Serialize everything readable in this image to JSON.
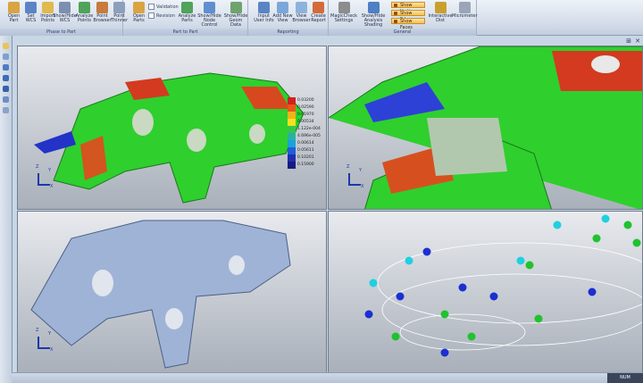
{
  "ribbon": {
    "groups": [
      {
        "title": "Phase to Part"
      },
      {
        "title": "Part to Part"
      },
      {
        "title": "Reporting"
      },
      {
        "title": "General"
      }
    ],
    "buttons": [
      {
        "label": "Open\nPart",
        "color": "#d9a441"
      },
      {
        "label": "Set\nWCS",
        "color": "#5a84c6"
      },
      {
        "label": "Import\nPoints",
        "color": "#e0b94f"
      },
      {
        "label": "Show/Hide\nWCS",
        "color": "#7b8fb0"
      },
      {
        "label": "Analyze\nPoints",
        "color": "#4fa35b"
      },
      {
        "label": "Point\nBrowser",
        "color": "#c77b3d"
      },
      {
        "label": "Point\nThinner",
        "color": "#8c9fbc"
      },
      {
        "label": "Open\nParts",
        "color": "#d9a441"
      },
      {
        "label": "Analyze\nParts",
        "color": "#4fa35b"
      },
      {
        "label": "Show/Hide\nNode Control",
        "color": "#5f8fd1"
      },
      {
        "label": "Show/Hide\nGeom Data",
        "color": "#6fa36e"
      },
      {
        "label": "Input\nUser Info",
        "color": "#5a84c6"
      },
      {
        "label": "Add New\nView",
        "color": "#7aa7d9"
      },
      {
        "label": "View\nBrowser",
        "color": "#8eb2de"
      },
      {
        "label": "Create\nReport",
        "color": "#d46c3a"
      },
      {
        "label": "MagicCheck\nSettings",
        "color": "#8d8d8d"
      },
      {
        "label": "Show/Hide\nAnalysis Shading",
        "color": "#4f7fc4"
      },
      {
        "label": "Interactive\nDist",
        "color": "#c9a030"
      },
      {
        "label": "Micrometer",
        "color": "#9aa5b8"
      }
    ],
    "checks": {
      "validation": "Validation",
      "revision": "Revision"
    },
    "toggles": [
      "Show Vertices",
      "Show Edges",
      "Show Faces"
    ]
  },
  "legend": {
    "entries": [
      {
        "label": "0.03200",
        "color": "#d31f1f"
      },
      {
        "label": "0.02590",
        "color": "#e8561a"
      },
      {
        "label": "0.01970",
        "color": "#f2b21a"
      },
      {
        "label": "0.00534",
        "color": "#f5e21d"
      },
      {
        "label": "1.122e-004",
        "color": "#33c64a"
      },
      {
        "label": "4.696e-005",
        "color": "#27b3a3"
      },
      {
        "label": "0.00614",
        "color": "#1aa3d8"
      },
      {
        "label": "0.05611",
        "color": "#1f5ed8"
      },
      {
        "label": "0.10201",
        "color": "#1c2fb0"
      },
      {
        "label": "0.15900",
        "color": "#161b80"
      }
    ]
  },
  "axis": {
    "x": "X",
    "y": "Y",
    "z": "Z"
  },
  "status": {
    "mode": "NUM"
  },
  "window": {
    "pin": "⊞",
    "close": "✕"
  }
}
